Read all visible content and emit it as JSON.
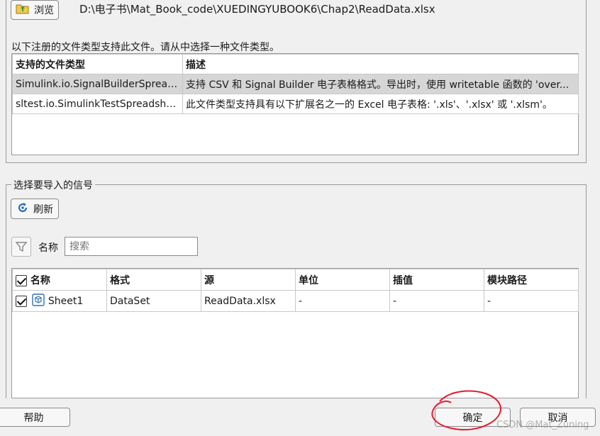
{
  "browse": {
    "label": "浏览",
    "path": "D:\\电子书\\Mat_Book_code\\XUEDINGYUBOOK6\\Chap2\\ReadData.xlsx"
  },
  "filetypes": {
    "hint": "以下注册的文件类型支持此文件。请从中选择一种文件类型。",
    "headers": [
      "支持的文件类型",
      "描述"
    ],
    "rows": [
      {
        "type": "Simulink.io.SignalBuilderSpreads...",
        "desc": "支持 CSV 和 Signal Builder 电子表格格式。导出时，使用 writetable 函数的 'over...",
        "selected": true
      },
      {
        "type": "sltest.io.SimulinkTestSpreadsheet",
        "desc": "此文件类型支持具有以下扩展名之一的 Excel 电子表格: '.xls'、'.xlsx' 或 '.xlsm'。",
        "selected": false
      }
    ]
  },
  "signals": {
    "group_title": "选择要导入的信号",
    "refresh_label": "刷新",
    "filter_label": "名称",
    "search_placeholder": "搜索",
    "headers": [
      "名称",
      "格式",
      "源",
      "单位",
      "插值",
      "模块路径"
    ],
    "rows": [
      {
        "name": "Sheet1",
        "format": "DataSet",
        "source": "ReadData.xlsx",
        "unit": "-",
        "interp": "-",
        "blockpath": "-",
        "checked": true
      }
    ]
  },
  "footer": {
    "help": "帮助",
    "ok": "确定",
    "cancel": "取消",
    "watermark": "CSDN @Mat_Zuning"
  },
  "colors": {
    "annotation": "#e8192c",
    "selected_row": "#d6d6d6"
  }
}
